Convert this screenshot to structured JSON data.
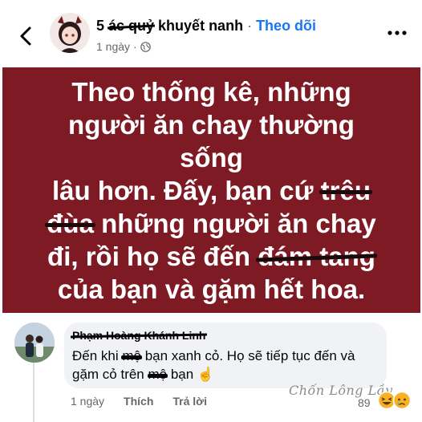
{
  "header": {
    "name_prefix": "5 ",
    "name_struck": "ác quỷ",
    "name_suffix": " khuyết nanh",
    "separator": " · ",
    "follow_label": "Theo dõi",
    "time": "1 ngày",
    "privacy_sep": "·"
  },
  "post": {
    "line1": "Theo thống kê, những",
    "line2": "người ăn chay thường sống",
    "line3_a": "lâu hơn. Đấy, bạn cứ ",
    "line3_struck": "trêu",
    "line4_struck": "đùa",
    "line4_b": " những người ăn chay",
    "line5_a": "đi, rồi họ sẽ đến ",
    "line5_struck": "đám tang",
    "line6": "của bạn và gặm hết hoa.",
    "background": "#7e1a24"
  },
  "comment": {
    "author": "Phạm Hoàng Khánh Linh",
    "text_a": "Đến khi ",
    "scribble1": "mộ",
    "text_b": " bạn xanh cỏ. Họ sẽ tiếp tục đến và gặm cỏ trên ",
    "scribble2": "mộ",
    "text_c": " bạn ☝",
    "time": "1 ngày",
    "like_label": "Thích",
    "reply_label": "Trả lời",
    "reaction_count": "89"
  },
  "watermark": "Chốn Lông Lầy",
  "colors": {
    "link": "#1877f2",
    "muted": "#65676b",
    "bubble": "#f0f2f5"
  }
}
